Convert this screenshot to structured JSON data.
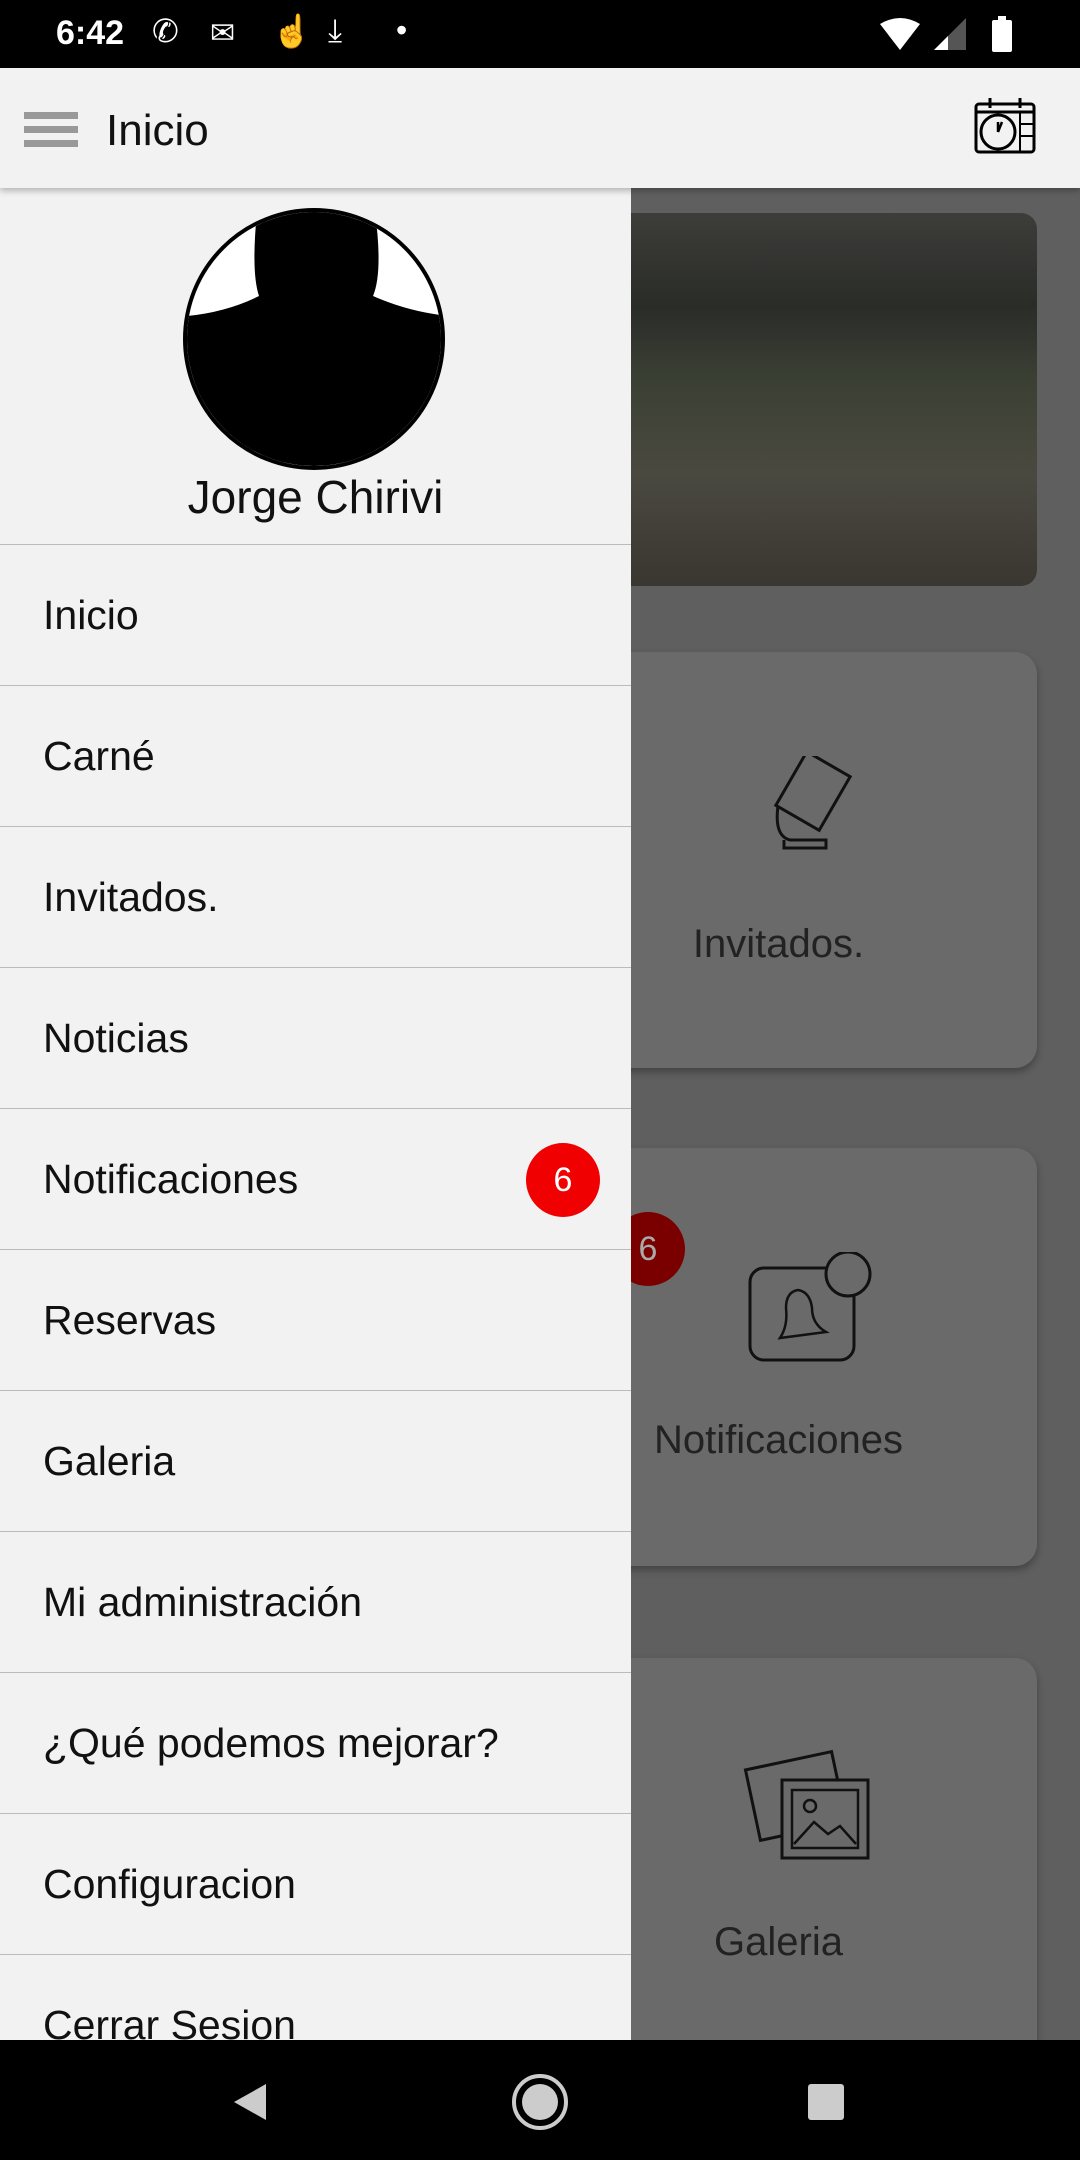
{
  "status_bar": {
    "time": "6:42",
    "icons": [
      "phone-icon",
      "gmail-icon",
      "touch-icon",
      "download-icon",
      "dot-icon",
      "wifi-icon",
      "signal-icon",
      "battery-icon"
    ]
  },
  "app_bar": {
    "title": "Inicio",
    "menu_icon": "hamburger-icon",
    "action_icon": "calendar-clock-icon"
  },
  "drawer": {
    "user_name": "Jorge Chirivi",
    "items": [
      {
        "label": "Inicio"
      },
      {
        "label": "Carné"
      },
      {
        "label": "Invitados."
      },
      {
        "label": "Noticias"
      },
      {
        "label": "Notificaciones",
        "badge": "6"
      },
      {
        "label": "Reservas"
      },
      {
        "label": "Galeria"
      },
      {
        "label": "Mi administración"
      },
      {
        "label": "¿Qué podemos mejorar?"
      },
      {
        "label": "Configuracion"
      },
      {
        "label": "Cerrar Sesion"
      }
    ]
  },
  "background": {
    "cards": [
      {
        "label": "Invitados."
      },
      {
        "label": "Notificaciones",
        "badge": "6"
      },
      {
        "label": "Galeria"
      }
    ]
  },
  "colors": {
    "badge": "#f00000",
    "drawer_bg": "#f2f2f2",
    "scrim": "#5f5f5f"
  }
}
